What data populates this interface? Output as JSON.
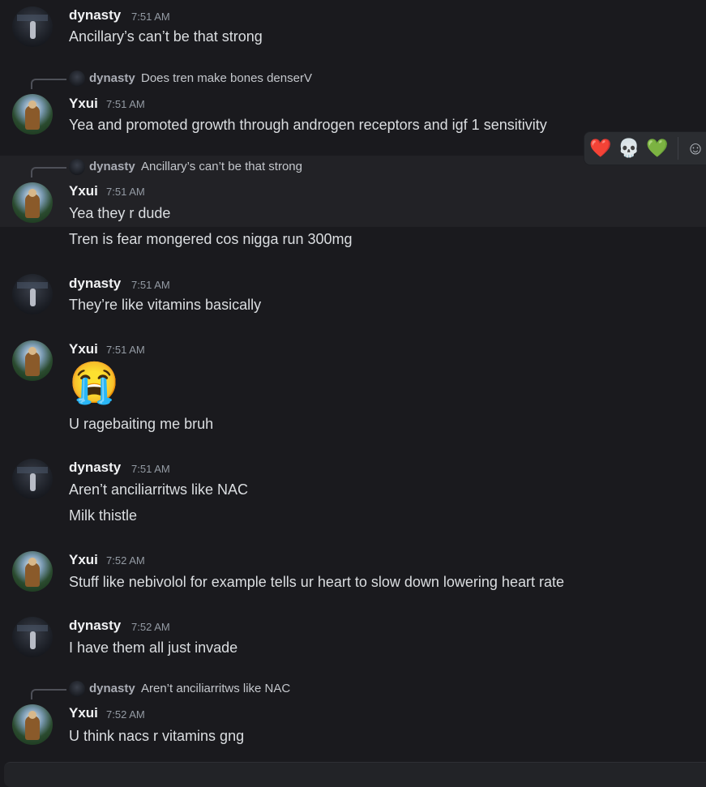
{
  "messages": [
    {
      "author": "dynasty",
      "time": "7:51 AM",
      "lines": [
        "Ancillary’s can’t be that strong"
      ]
    },
    {
      "reply": {
        "author": "dynasty",
        "text": "Does tren make bones denserV"
      },
      "author": "Yxui",
      "time": "7:51 AM",
      "lines": [
        "Yea and promoted growth through androgen receptors and igf 1 sensitivity"
      ]
    },
    {
      "reply": {
        "author": "dynasty",
        "text": "Ancillary’s can’t be that strong"
      },
      "author": "Yxui",
      "time": "7:51 AM",
      "lines": [
        "Yea they r dude",
        "Tren is fear mongered cos nigga run 300mg"
      ]
    },
    {
      "author": "dynasty",
      "time": "7:51 AM",
      "lines": [
        "They’re like vitamins basically"
      ]
    },
    {
      "author": "Yxui",
      "time": "7:51 AM",
      "emoji": "😭",
      "lines": [
        "U ragebaiting me bruh"
      ]
    },
    {
      "author": "dynasty",
      "time": "7:51 AM",
      "lines": [
        "Aren’t anciliarritws like NAC",
        "Milk thistle"
      ]
    },
    {
      "author": "Yxui",
      "time": "7:52 AM",
      "lines": [
        "Stuff like nebivolol for example tells ur heart to slow down lowering heart rate"
      ]
    },
    {
      "author": "dynasty",
      "time": "7:52 AM",
      "lines": [
        "I have them  all just invade"
      ]
    },
    {
      "reply": {
        "author": "dynasty",
        "text": "Aren’t anciliarritws like NAC"
      },
      "author": "Yxui",
      "time": "7:52 AM",
      "lines": [
        "U think nacs r vitamins gng"
      ]
    }
  ],
  "reaction_bar": {
    "items": [
      "❤️",
      "💀",
      "💚",
      "☺"
    ]
  }
}
